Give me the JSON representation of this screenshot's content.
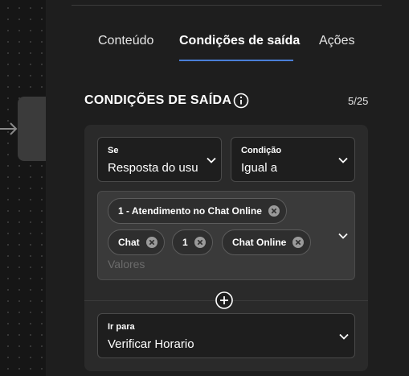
{
  "tabs": [
    {
      "label": "Conteúdo",
      "active": false
    },
    {
      "label": "Condições de saída",
      "active": true
    },
    {
      "label": "Ações",
      "active": false
    }
  ],
  "section": {
    "title": "CONDIÇÕES DE SAÍDA",
    "counter": "5/25"
  },
  "condition": {
    "se": {
      "label": "Se",
      "value": "Resposta do usuá"
    },
    "condicao": {
      "label": "Condição",
      "value": "Igual a"
    },
    "values": {
      "chips": [
        "1 - Atendimento no Chat Online",
        "Chat",
        "1",
        "Chat Online"
      ],
      "placeholder": "Valores"
    },
    "ir_para": {
      "label": "Ir para",
      "value": "Verificar Horario"
    }
  },
  "colors": {
    "accent": "#4a7fd8",
    "panel": "#1e1e1e",
    "card": "#2a2a2a"
  }
}
